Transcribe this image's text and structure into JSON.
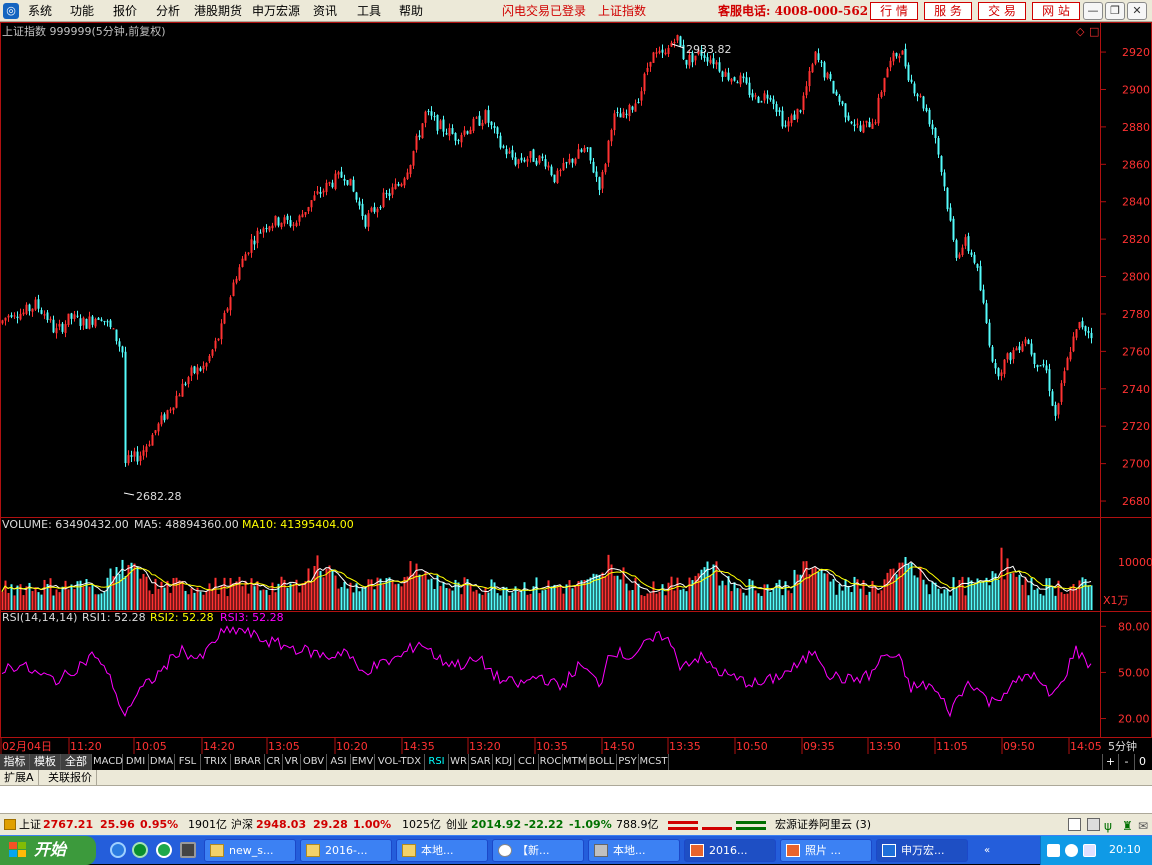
{
  "menu": {
    "items": [
      "系统",
      "功能",
      "报价",
      "分析",
      "港股期货",
      "申万宏源",
      "资讯",
      "工具",
      "帮助"
    ],
    "flash_login": "闪电交易已登录",
    "index_name": "上证指数",
    "service_phone": "客服电话: 4008-000-562",
    "top_buttons": [
      "行 情",
      "服 务",
      "交 易",
      "网 站"
    ]
  },
  "chart_header": {
    "title": "上证指数 999999(5分钟,前复权)"
  },
  "price_axis": {
    "ticks": [
      "2920",
      "2900",
      "2880",
      "2860",
      "2840",
      "2820",
      "2800",
      "2780",
      "2760",
      "2740",
      "2720",
      "2700",
      "2680"
    ],
    "high_label": "2933.82",
    "low_label": "2682.28"
  },
  "volume_pane": {
    "label": "VOLUME: 63490432.00",
    "ma5": "MA5: 48894360.00",
    "ma10": "MA10: 41395404.00",
    "tick": "10000",
    "unit": "X1万"
  },
  "rsi_pane": {
    "name": "RSI(14,14,14)",
    "rsi1": "RSI1: 52.28",
    "rsi2": "RSI2: 52.28",
    "rsi3": "RSI3: 52.28",
    "ticks": [
      "80.00",
      "50.00",
      "20.00"
    ]
  },
  "time_axis": {
    "labels": [
      "02月04日",
      "11:20",
      "10:05",
      "14:20",
      "13:05",
      "10:20",
      "14:35",
      "13:20",
      "10:35",
      "14:50",
      "13:35",
      "10:50",
      "09:35",
      "13:50",
      "11:05",
      "09:50",
      "14:05"
    ],
    "period": "5分钟"
  },
  "indicator_tabs": {
    "category": [
      "指标",
      "模板",
      "全部"
    ],
    "tabs": [
      "MACD",
      "DMI",
      "DMA",
      "FSL",
      "TRIX",
      "BRAR",
      "CR",
      "VR",
      "OBV",
      "ASI",
      "EMV",
      "VOL-TDX",
      "RSI",
      "WR",
      "SAR",
      "KDJ",
      "CCI",
      "ROC",
      "MTM",
      "BOLL",
      "PSY",
      "MCST"
    ],
    "active": "RSI",
    "nav": [
      "+",
      "-",
      "0"
    ]
  },
  "ext_tabs": [
    "扩展A",
    "关联报价"
  ],
  "status": {
    "sh_label": "上证",
    "sh_value": "2767.21",
    "sh_change": "25.96",
    "sh_pct": "0.95%",
    "sh_amount": "1901亿",
    "hs_label": "沪深",
    "hs_value": "2948.03",
    "hs_change": "29.28",
    "hs_pct": "1.00%",
    "hs_amount": "1025亿",
    "cy_label": "创业",
    "cy_value": "2014.92",
    "cy_change": "-22.22",
    "cy_pct": "-1.09%",
    "cy_amount": "788.9亿",
    "server": "宏源证券阿里云 (3)"
  },
  "taskbar": {
    "start": "开始",
    "tasks": [
      "new_s...",
      "2016-...",
      "本地...",
      "【新...",
      "本地...",
      "2016...",
      "照片 ...",
      "申万宏..."
    ],
    "clock": "20:10"
  },
  "colors": {
    "up": "#ff3232",
    "down": "#54fcfc",
    "grid": "#b01010",
    "ma5": "#ffffff",
    "ma10": "#ffff00",
    "rsi": "#ff00ff"
  },
  "chart_data": {
    "type": "candlestick",
    "price_range": [
      2672,
      2935
    ],
    "high": 2933.82,
    "low": 2682.28,
    "close_anchors": [
      [
        0,
        2775
      ],
      [
        12,
        2782
      ],
      [
        22,
        2780
      ],
      [
        35,
        2785
      ],
      [
        45,
        2780
      ],
      [
        55,
        2770
      ],
      [
        70,
        2778
      ],
      [
        85,
        2775
      ],
      [
        100,
        2780
      ],
      [
        115,
        2768
      ],
      [
        122,
        2760
      ],
      [
        124,
        2700
      ],
      [
        140,
        2705
      ],
      [
        160,
        2722
      ],
      [
        175,
        2735
      ],
      [
        190,
        2748
      ],
      [
        205,
        2752
      ],
      [
        220,
        2770
      ],
      [
        235,
        2800
      ],
      [
        250,
        2818
      ],
      [
        265,
        2828
      ],
      [
        280,
        2830
      ],
      [
        295,
        2828
      ],
      [
        310,
        2840
      ],
      [
        330,
        2850
      ],
      [
        345,
        2855
      ],
      [
        365,
        2830
      ],
      [
        380,
        2840
      ],
      [
        400,
        2850
      ],
      [
        410,
        2862
      ],
      [
        425,
        2887
      ],
      [
        440,
        2880
      ],
      [
        455,
        2875
      ],
      [
        470,
        2880
      ],
      [
        485,
        2886
      ],
      [
        500,
        2870
      ],
      [
        515,
        2862
      ],
      [
        530,
        2864
      ],
      [
        545,
        2862
      ],
      [
        555,
        2852
      ],
      [
        570,
        2862
      ],
      [
        585,
        2868
      ],
      [
        600,
        2848
      ],
      [
        605,
        2862
      ],
      [
        612,
        2885
      ],
      [
        625,
        2885
      ],
      [
        640,
        2898
      ],
      [
        650,
        2918
      ],
      [
        665,
        2918
      ],
      [
        675,
        2930
      ],
      [
        685,
        2915
      ],
      [
        700,
        2920
      ],
      [
        715,
        2915
      ],
      [
        725,
        2908
      ],
      [
        740,
        2905
      ],
      [
        755,
        2895
      ],
      [
        770,
        2898
      ],
      [
        785,
        2880
      ],
      [
        800,
        2890
      ],
      [
        815,
        2918
      ],
      [
        830,
        2903
      ],
      [
        845,
        2888
      ],
      [
        860,
        2878
      ],
      [
        875,
        2885
      ],
      [
        885,
        2910
      ],
      [
        900,
        2922
      ],
      [
        910,
        2905
      ],
      [
        925,
        2890
      ],
      [
        935,
        2875
      ],
      [
        945,
        2845
      ],
      [
        955,
        2812
      ],
      [
        965,
        2818
      ],
      [
        975,
        2808
      ],
      [
        985,
        2778
      ],
      [
        995,
        2748
      ],
      [
        1010,
        2758
      ],
      [
        1025,
        2768
      ],
      [
        1035,
        2755
      ],
      [
        1045,
        2752
      ],
      [
        1055,
        2725
      ],
      [
        1060,
        2738
      ],
      [
        1070,
        2762
      ],
      [
        1080,
        2775
      ],
      [
        1090,
        2770
      ]
    ],
    "rsi_anchors": [
      [
        0,
        52
      ],
      [
        20,
        55
      ],
      [
        40,
        48
      ],
      [
        60,
        45
      ],
      [
        80,
        55
      ],
      [
        95,
        62
      ],
      [
        115,
        40
      ],
      [
        122,
        22
      ],
      [
        140,
        38
      ],
      [
        160,
        50
      ],
      [
        180,
        65
      ],
      [
        200,
        58
      ],
      [
        220,
        75
      ],
      [
        240,
        78
      ],
      [
        260,
        72
      ],
      [
        280,
        68
      ],
      [
        300,
        65
      ],
      [
        330,
        60
      ],
      [
        345,
        65
      ],
      [
        360,
        50
      ],
      [
        380,
        55
      ],
      [
        400,
        60
      ],
      [
        420,
        70
      ],
      [
        440,
        58
      ],
      [
        460,
        55
      ],
      [
        480,
        58
      ],
      [
        500,
        45
      ],
      [
        520,
        42
      ],
      [
        540,
        48
      ],
      [
        560,
        40
      ],
      [
        580,
        55
      ],
      [
        600,
        42
      ],
      [
        610,
        65
      ],
      [
        630,
        60
      ],
      [
        650,
        70
      ],
      [
        665,
        75
      ],
      [
        680,
        55
      ],
      [
        700,
        60
      ],
      [
        720,
        50
      ],
      [
        740,
        45
      ],
      [
        760,
        42
      ],
      [
        780,
        48
      ],
      [
        800,
        55
      ],
      [
        815,
        65
      ],
      [
        830,
        48
      ],
      [
        850,
        45
      ],
      [
        870,
        48
      ],
      [
        885,
        62
      ],
      [
        900,
        58
      ],
      [
        910,
        40
      ],
      [
        930,
        42
      ],
      [
        950,
        25
      ],
      [
        970,
        45
      ],
      [
        990,
        30
      ],
      [
        1010,
        40
      ],
      [
        1030,
        50
      ],
      [
        1050,
        35
      ],
      [
        1060,
        40
      ],
      [
        1075,
        65
      ],
      [
        1090,
        55
      ]
    ]
  }
}
